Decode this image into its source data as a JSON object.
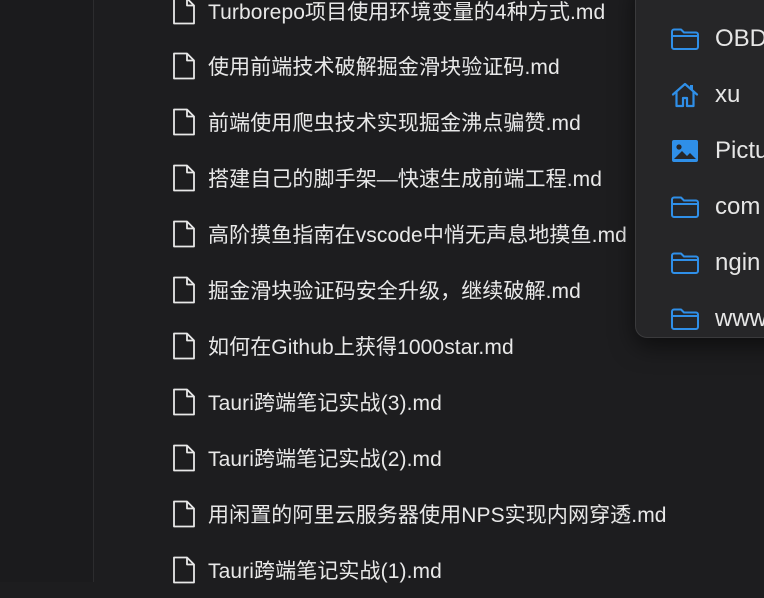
{
  "accent_color": "#2f8fe8",
  "files": [
    {
      "name": "Turborepo项目使用环境变量的4种方式.md",
      "icon": "document-icon"
    },
    {
      "name": "使用前端技术破解掘金滑块验证码.md",
      "icon": "document-icon"
    },
    {
      "name": "前端使用爬虫技术实现掘金沸点骗赞.md",
      "icon": "document-icon"
    },
    {
      "name": "搭建自己的脚手架—快速生成前端工程.md",
      "icon": "document-icon"
    },
    {
      "name": "高阶摸鱼指南在vscode中悄无声息地摸鱼.md",
      "icon": "document-icon"
    },
    {
      "name": "掘金滑块验证码安全升级，继续破解.md",
      "icon": "document-icon"
    },
    {
      "name": "如何在Github上获得1000star.md",
      "icon": "document-icon"
    },
    {
      "name": "Tauri跨端笔记实战(3).md",
      "icon": "document-icon"
    },
    {
      "name": "Tauri跨端笔记实战(2).md",
      "icon": "document-icon"
    },
    {
      "name": "用闲置的阿里云服务器使用NPS实现内网穿透.md",
      "icon": "document-icon"
    },
    {
      "name": "Tauri跨端笔记实战(1).md",
      "icon": "document-icon"
    }
  ],
  "popover": {
    "items": [
      {
        "label": "OBD",
        "icon": "folder-icon"
      },
      {
        "label": "xu",
        "icon": "home-icon"
      },
      {
        "label": "Pictu",
        "icon": "pictures-icon"
      },
      {
        "label": "com",
        "icon": "folder-icon"
      },
      {
        "label": "ngin",
        "icon": "folder-icon"
      },
      {
        "label": "www",
        "icon": "folder-icon"
      }
    ]
  }
}
